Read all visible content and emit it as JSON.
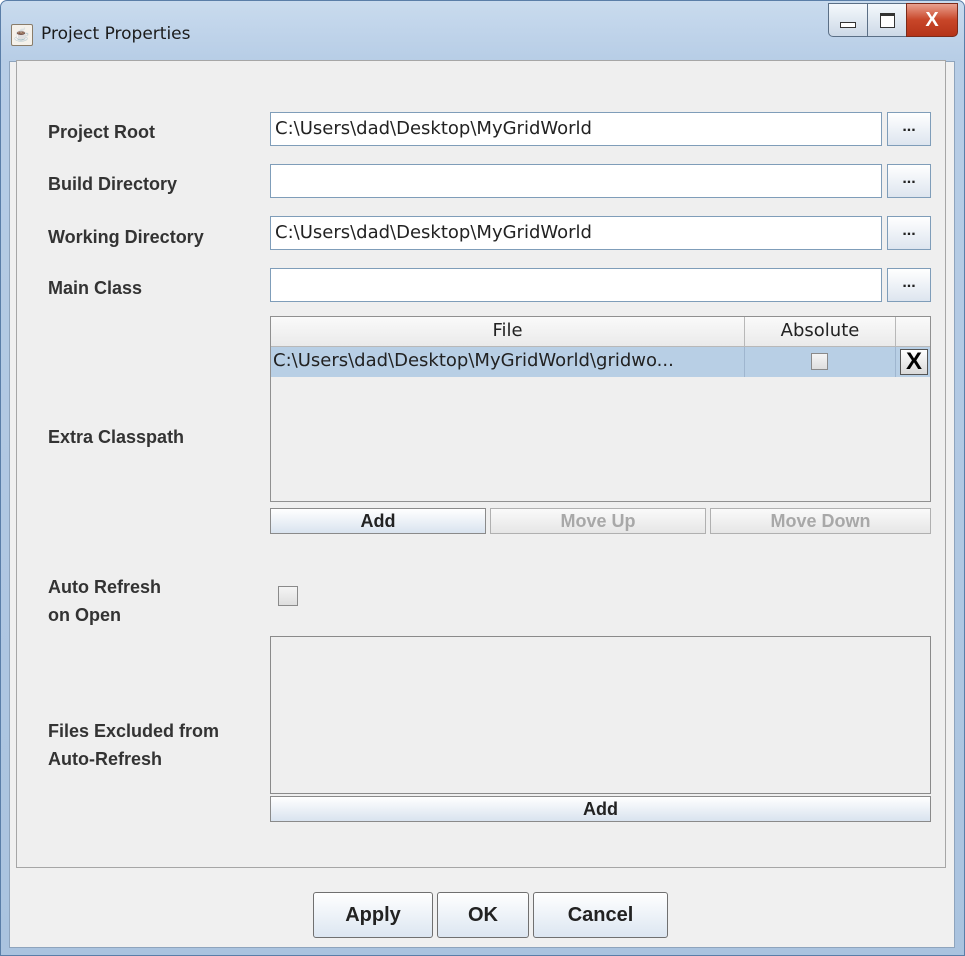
{
  "window": {
    "title": "Project Properties",
    "icon": "java-cup-icon"
  },
  "controls": {
    "minimize_icon": "minimize-icon",
    "maximize_icon": "maximize-icon",
    "close_glyph": "X"
  },
  "form": {
    "project_root": {
      "label": "Project Root",
      "value": "C:\\Users\\dad\\Desktop\\MyGridWorld",
      "browse": "..."
    },
    "build_directory": {
      "label": "Build Directory",
      "value": "",
      "browse": "..."
    },
    "working_directory": {
      "label": "Working Directory",
      "value": "C:\\Users\\dad\\Desktop\\MyGridWorld",
      "browse": "..."
    },
    "main_class": {
      "label": "Main Class",
      "value": "",
      "browse": "..."
    }
  },
  "classpath": {
    "label": "Extra Classpath",
    "columns": [
      "File",
      "Absolute",
      ""
    ],
    "rows": [
      {
        "file": "C:\\Users\\dad\\Desktop\\MyGridWorld\\gridwo...",
        "absolute": false,
        "remove": "X"
      }
    ],
    "buttons": {
      "add": "Add",
      "move_up": "Move Up",
      "move_down": "Move Down"
    }
  },
  "auto_refresh": {
    "label_line1": "Auto Refresh",
    "label_line2": "on Open",
    "checked": false
  },
  "excluded": {
    "label_line1": "Files Excluded from",
    "label_line2": "Auto-Refresh",
    "add": "Add"
  },
  "footer": {
    "apply": "Apply",
    "ok": "OK",
    "cancel": "Cancel"
  }
}
